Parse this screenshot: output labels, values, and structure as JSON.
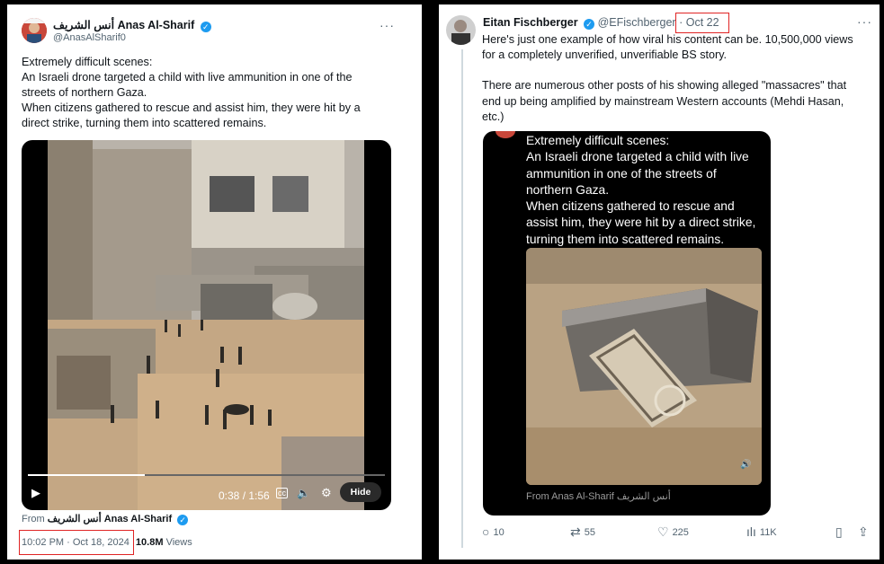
{
  "left_tweet": {
    "author_name": "Anas Al-Sharif",
    "author_name_arabic": "أنس الشريف",
    "handle": "@AnasAlSharif0",
    "more": "···",
    "text_lines": [
      "Extremely difficult scenes:",
      "An Israeli drone targeted a child with live ammunition in one of the",
      "streets of northern Gaza.",
      "When citizens gathered to rescue and assist him, they were hit by a",
      "direct strike, turning them into scattered remains."
    ],
    "video": {
      "time": "0:38 / 1:56",
      "progress": 0.327,
      "hide_label": "Hide"
    },
    "from_label": "From",
    "from_name_arabic": "أنس الشريف",
    "from_name": "Anas Al-Sharif",
    "timestamp": "10:02 PM · Oct 18, 2024",
    "views_count": "10.8M",
    "views_label": "Views"
  },
  "right_tweet": {
    "author_name": "Eitan Fischberger",
    "handle": "@EFischberger",
    "separator": "·",
    "date": "Oct 22",
    "more": "···",
    "text_lines": [
      "Here's just one example of how viral his content can be. 10,500,000 views",
      "for a completely unverified, unverifiable BS story.",
      "",
      "There are numerous other posts of his showing alleged \"massacres\" that",
      "end up being amplified by mainstream Western accounts (Mehdi Hasan,",
      "etc.)"
    ],
    "embedded": {
      "text_lines": [
        "Extremely difficult scenes:",
        "An Israeli drone targeted a child with live",
        "ammunition in one of the streets of",
        "northern Gaza.",
        "When citizens gathered to rescue and",
        "assist him, they were hit by a direct strike,",
        "turning them into scattered remains."
      ],
      "from": "From Anas Al-Sharif أنس الشريف"
    },
    "actions": {
      "replies": "10",
      "reposts": "55",
      "likes": "225",
      "views": "11K"
    }
  },
  "colors": {
    "accent": "#1d9bf0",
    "highlight_box": "#e02424",
    "muted_text": "#536471"
  }
}
